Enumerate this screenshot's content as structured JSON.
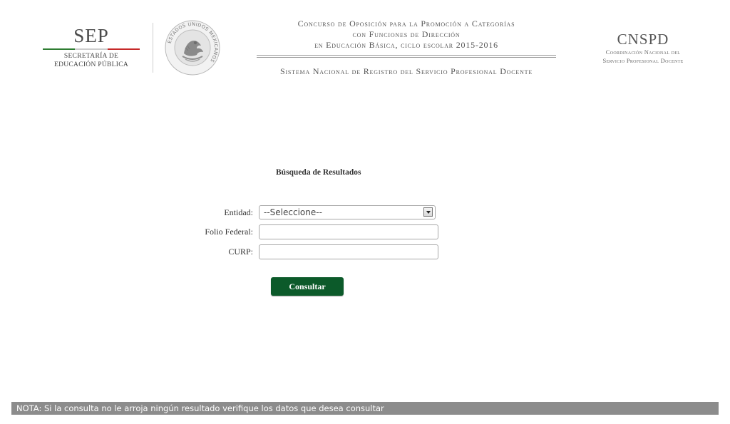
{
  "header": {
    "sep": {
      "title": "SEP",
      "subtitle_line1": "SECRETARÍA DE",
      "subtitle_line2": "EDUCACIÓN PÚBLICA",
      "colors": {
        "green": "#2e7d32",
        "red": "#c62828"
      }
    },
    "seal": {
      "icon": "mexican-coat-of-arms",
      "ring_text": "ESTADOS UNIDOS MEXICANOS"
    },
    "contest": {
      "line1": "Concurso de Oposición para la Promoción a Categorías",
      "line2": "con Funciones de Dirección",
      "line3": "en Educación Básica, ciclo escolar 2015-2016"
    },
    "system_name": "Sistema Nacional de Registro del Servicio Profesional Docente",
    "cnspd": {
      "title": "CNSPD",
      "subtitle_line1": "Coordinación Nacional del",
      "subtitle_line2": "Servicio Profesional Docente"
    }
  },
  "form": {
    "title": "Búsqueda de Resultados",
    "entidad": {
      "label": "Entidad:",
      "selected": "--Seleccione--"
    },
    "folio": {
      "label": "Folio Federal:",
      "value": ""
    },
    "curp": {
      "label": "CURP:",
      "value": ""
    },
    "submit_label": "Consultar",
    "button_color": "#0c5a2a"
  },
  "footer": {
    "nota": "NOTA: Si la consulta no le arroja ningún resultado verifique los datos que desea consultar"
  }
}
